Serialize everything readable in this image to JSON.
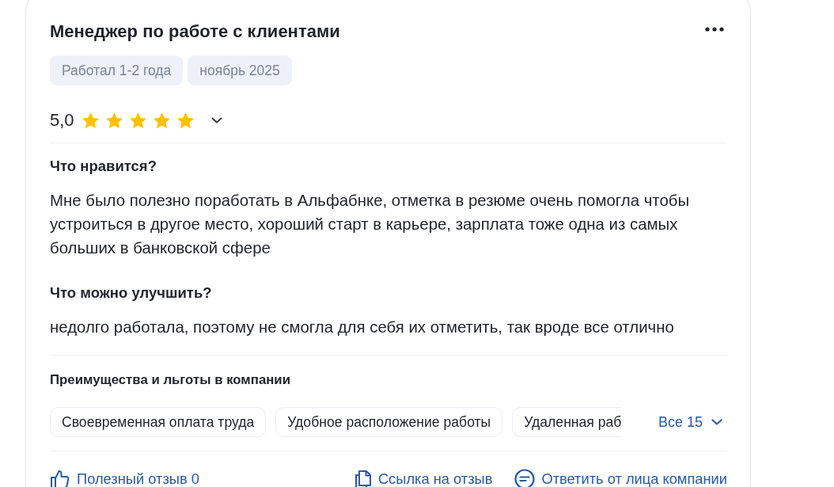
{
  "review": {
    "title": "Менеджер по работе с клиентами",
    "tags": [
      "Работал 1-2 года",
      "ноябрь 2025"
    ],
    "rating": {
      "score": "5,0",
      "stars": 5
    },
    "sections": [
      {
        "heading": "Что нравится?",
        "text": "Мне было полезно поработать в Альфабнке, отметка в резюме очень помогла чтобы устроиться в другое место, хороший старт в карьере, зарплата тоже одна из самых больших в банковской сфере"
      },
      {
        "heading": "Что можно улучшить?",
        "text": "недолго работала, поэтому не смогла для себя их отметить, так вроде все отлично"
      }
    ],
    "benefits": {
      "heading": "Преимущества и льготы в компании",
      "items": [
        "Своевременная оплата труда",
        "Удобное расположение работы",
        "Удаленная раб"
      ],
      "more_link": "Все 15"
    },
    "actions": [
      {
        "kind": "helpful",
        "label": "Полезный отзыв 0"
      },
      {
        "kind": "link",
        "label": "Ссылка на отзыв"
      },
      {
        "kind": "reply",
        "label": "Ответить от лица компании"
      }
    ]
  }
}
